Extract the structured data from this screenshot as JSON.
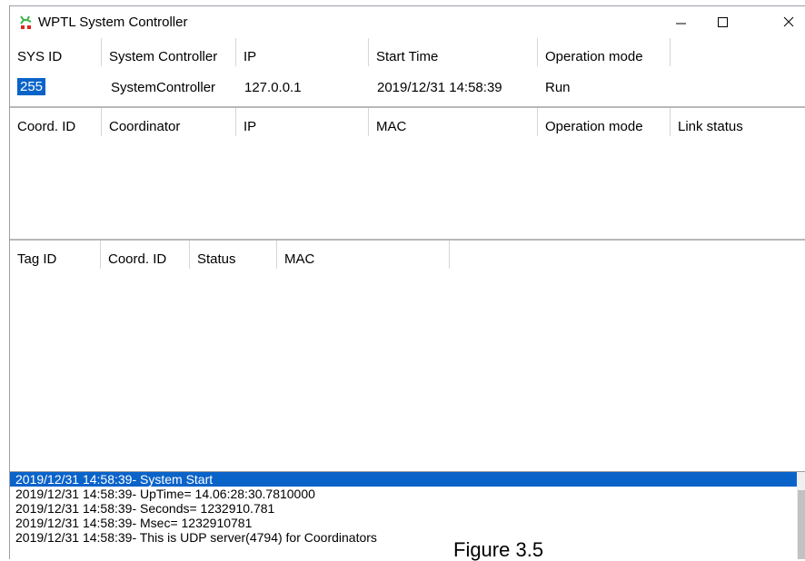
{
  "window": {
    "title": "WPTL System Controller"
  },
  "system_grid": {
    "headers": [
      "SYS ID",
      "System Controller",
      "IP",
      "Start Time",
      "Operation mode"
    ],
    "row": {
      "sys_id": "255",
      "system_controller": "SystemController",
      "ip": "127.0.0.1",
      "start_time": "2019/12/31 14:58:39",
      "operation_mode": "Run"
    }
  },
  "coordinator_grid": {
    "headers": [
      "Coord. ID",
      "Coordinator",
      "IP",
      "MAC",
      "Operation mode",
      "Link status"
    ]
  },
  "tag_grid": {
    "headers": [
      "Tag ID",
      "Coord. ID",
      "Status",
      "MAC"
    ]
  },
  "log": {
    "lines": [
      "2019/12/31 14:58:39- System Start",
      "2019/12/31 14:58:39- UpTime= 14.06:28:30.7810000",
      "2019/12/31 14:58:39- Seconds= 1232910.781",
      "2019/12/31 14:58:39- Msec= 1232910781",
      "2019/12/31 14:58:39- This is UDP server(4794) for Coordinators"
    ]
  },
  "caption": "Figure 3.5",
  "icons": [
    "wptl-app-icon",
    "minimize-icon",
    "maximize-icon",
    "close-icon"
  ],
  "colors": {
    "selection": "#0a63c9",
    "app_icon_green": "#39b54a",
    "app_icon_red": "#e02424"
  }
}
